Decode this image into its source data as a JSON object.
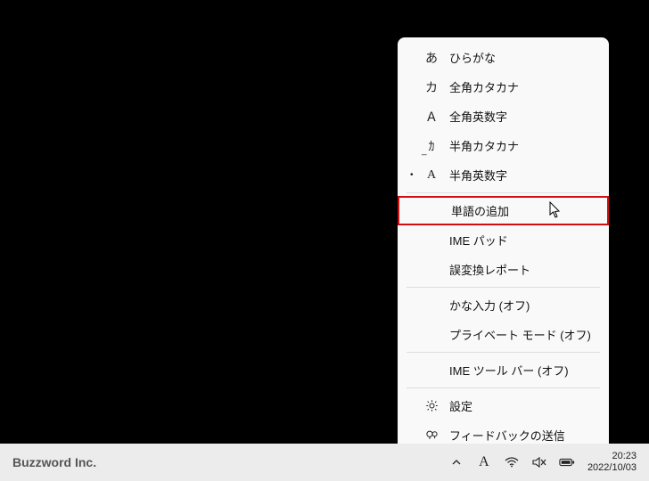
{
  "menu": {
    "groups": [
      [
        {
          "icon": "あ",
          "label": "ひらがな",
          "selected": false,
          "iname": "hiragana-icon",
          "name": "menu-item-hiragana"
        },
        {
          "icon": "カ",
          "label": "全角カタカナ",
          "selected": false,
          "iname": "katakana-full-icon",
          "name": "menu-item-katakana-full"
        },
        {
          "icon": "Ａ",
          "label": "全角英数字",
          "selected": false,
          "iname": "alnum-full-icon",
          "name": "menu-item-alnum-full"
        },
        {
          "icon": "_ｶ",
          "label": "半角カタカナ",
          "selected": false,
          "iname": "katakana-half-icon",
          "name": "menu-item-katakana-half"
        },
        {
          "icon": "A",
          "label": "半角英数字",
          "selected": true,
          "iname": "alnum-half-icon",
          "name": "menu-item-alnum-half"
        }
      ],
      [
        {
          "icon": "",
          "label": "単語の追加",
          "highlight": true,
          "name": "menu-item-add-word"
        },
        {
          "icon": "",
          "label": "IME パッド",
          "name": "menu-item-ime-pad"
        },
        {
          "icon": "",
          "label": "誤変換レポート",
          "name": "menu-item-misconversion-report"
        }
      ],
      [
        {
          "icon": "",
          "label": "かな入力 (オフ)",
          "name": "menu-item-kana-input"
        },
        {
          "icon": "",
          "label": "プライベート モード (オフ)",
          "name": "menu-item-private-mode"
        }
      ],
      [
        {
          "icon": "",
          "label": "IME ツール バー (オフ)",
          "name": "menu-item-ime-toolbar"
        }
      ],
      [
        {
          "icon": "gear",
          "label": "設定",
          "iname": "gear-icon",
          "name": "menu-item-settings"
        },
        {
          "icon": "feedback",
          "label": "フィードバックの送信",
          "iname": "feedback-icon",
          "name": "menu-item-feedback"
        }
      ]
    ]
  },
  "taskbar": {
    "brand": "Buzzword Inc.",
    "ime_mode": "A",
    "time": "20:23",
    "date": "2022/10/03"
  }
}
